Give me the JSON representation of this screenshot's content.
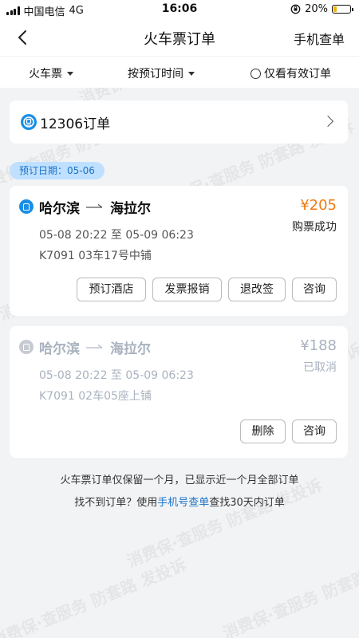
{
  "status_bar": {
    "carrier": "中国电信",
    "network": "4G",
    "time": "16:06",
    "battery_percent": "20%",
    "battery_level": 0.2
  },
  "nav": {
    "title": "火车票订单",
    "back_icon": "chevron-left-icon",
    "right_action": "手机查单"
  },
  "filters": [
    {
      "label": "火车票",
      "icon": "caret-down-icon"
    },
    {
      "label": "按预订时间",
      "icon": "caret-down-icon"
    },
    {
      "label": "仅看有效订单",
      "icon": "radio-icon"
    }
  ],
  "channel": {
    "label": "12306订单",
    "icon": "12306-logo-icon"
  },
  "date_group": {
    "label": "预订日期：05-06"
  },
  "orders": [
    {
      "from": "哈尔滨",
      "to": "海拉尔",
      "price": "¥205",
      "status": "购票成功",
      "time": "05-08 20:22 至 05-09 06:23",
      "seat": "K7091 03车17号中铺",
      "actions": [
        "预订酒店",
        "发票报销",
        "退改签",
        "咨询"
      ]
    },
    {
      "from": "哈尔滨",
      "to": "海拉尔",
      "price": "¥188",
      "status": "已取消",
      "time": "05-08 20:22 至 05-09 06:23",
      "seat": "K7091 02车05座上铺",
      "actions": [
        "删除",
        "咨询"
      ]
    }
  ],
  "footer": {
    "note": "火车票订单仅保留一个月，已显示近一个月全部订单",
    "prefix": "找不到订单？使用",
    "link": "手机号查单",
    "suffix": "查找30天内订单"
  },
  "watermark": "消费保·查服务 防套路 发投诉",
  "colors": {
    "accent_blue": "#1a73c8",
    "price_orange": "#f07a12",
    "disabled_gray": "#a9b2bf"
  }
}
